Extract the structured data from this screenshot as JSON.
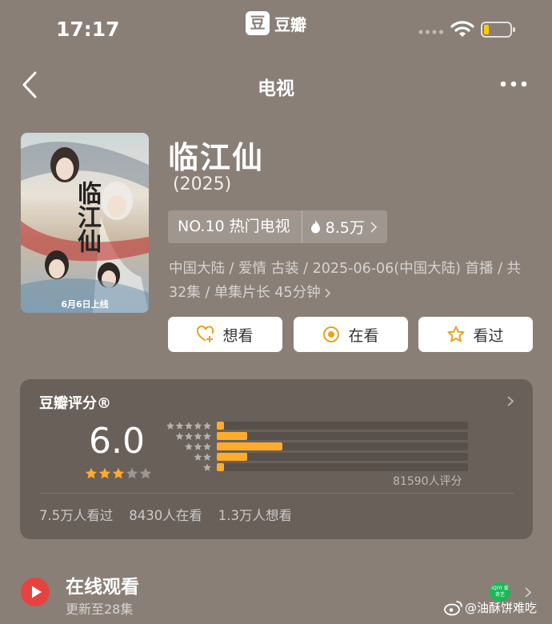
{
  "status_bar": {
    "time": "17:17",
    "app_logo_char": "豆",
    "app_name": "豆瓣"
  },
  "nav": {
    "title": "电视"
  },
  "show": {
    "poster_title": "临江仙",
    "poster_date": "6月6日上线",
    "title": "临江仙",
    "year": "(2025)",
    "rank_label": "NO.10 热门电视",
    "popularity": "8.5万",
    "meta": "中国大陆 / 爱情 古装 / 2025-06-06(中国大陆) 首播 / 共32集 / 单集片长 45分钟"
  },
  "actions": {
    "want": "想看",
    "watching": "在看",
    "watched": "看过"
  },
  "rating": {
    "heading": "豆瓣评分®",
    "score": "6.0",
    "stars_filled": 3,
    "stars_total": 5,
    "distribution_percent": [
      3,
      12,
      26,
      12,
      3
    ],
    "rater_count": "81590人评分",
    "stats": {
      "watched": "7.5万人看过",
      "watching": "8430人在看",
      "want": "1.3万人想看"
    }
  },
  "online": {
    "title": "在线观看",
    "subtitle": "更新至28集",
    "platform_badge": "iQIYI 爱奇艺"
  },
  "watermark": "@油酥饼难吃",
  "colors": {
    "background": "#8a7f77",
    "accent": "#ffac2d",
    "button_icon": "#e8a221"
  }
}
